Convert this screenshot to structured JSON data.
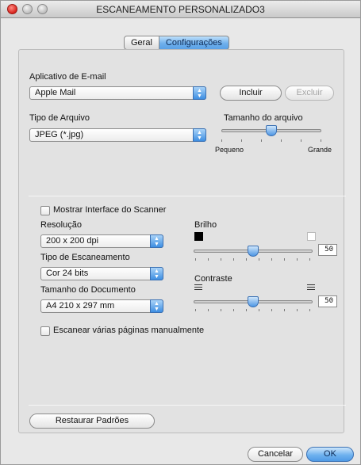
{
  "window": {
    "title": "ESCANEAMENTO PERSONALIZADO3"
  },
  "tabs": [
    {
      "label": "Geral",
      "selected": false
    },
    {
      "label": "Configurações",
      "selected": true
    }
  ],
  "email_app": {
    "label": "Aplicativo de E-mail",
    "value": "Apple Mail",
    "add_label": "Incluir",
    "remove_label": "Excluir"
  },
  "file_type": {
    "label": "Tipo de Arquivo",
    "value": "JPEG (*.jpg)"
  },
  "file_size": {
    "label": "Tamanho do arquivo",
    "min_label": "Pequeno",
    "max_label": "Grande",
    "level": 0.5
  },
  "scanner_ui": {
    "label": "Mostrar Interface do Scanner",
    "checked": false
  },
  "resolution": {
    "label": "Resolução",
    "value": "200 x 200 dpi"
  },
  "scan_type": {
    "label": "Tipo de Escaneamento",
    "value": "Cor 24 bits"
  },
  "doc_size": {
    "label": "Tamanho do Documento",
    "value": "A4 210 x 297 mm"
  },
  "brightness": {
    "label": "Brilho",
    "value": "50",
    "level": 0.5
  },
  "contrast": {
    "label": "Contraste",
    "value": "50",
    "level": 0.5
  },
  "manual_multi": {
    "label": "Escanear várias páginas manualmente",
    "checked": false
  },
  "buttons": {
    "restore": "Restaurar Padrões",
    "cancel": "Cancelar",
    "ok": "OK"
  },
  "colors": {
    "accent": "#5aa0e6",
    "close": "#d8231d"
  }
}
